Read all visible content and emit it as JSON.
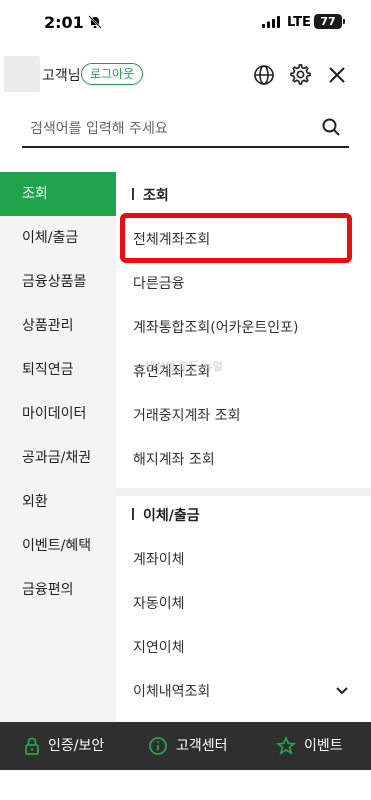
{
  "status_bar": {
    "time": "2:01",
    "network": "LTE",
    "battery": "77"
  },
  "header": {
    "user_name": "고객님",
    "logout_label": "로그아웃"
  },
  "search": {
    "placeholder": "검색어를 입력해 주세요"
  },
  "sidebar": {
    "items": [
      {
        "label": "조회",
        "active": true
      },
      {
        "label": "이체/출금"
      },
      {
        "label": "금융상품몰"
      },
      {
        "label": "상품관리"
      },
      {
        "label": "퇴직연금"
      },
      {
        "label": "마이데이터"
      },
      {
        "label": "공과금/채권"
      },
      {
        "label": "외환"
      },
      {
        "label": "이벤트/혜택"
      },
      {
        "label": "금융편의"
      }
    ]
  },
  "sections": [
    {
      "title": "조회",
      "items": [
        "전체계좌조회",
        "다른금융",
        "계좌통합조회(어카운트인포)",
        "휴면계좌조회",
        "거래중지계좌 조회",
        "해지계좌 조회"
      ]
    },
    {
      "title": "이체/출금",
      "items": [
        "계좌이체",
        "자동이체",
        "지연이체",
        "이체내역조회"
      ]
    }
  ],
  "watermark": "세상의 모든 뉴얼",
  "footer": {
    "items": [
      "인증/보안",
      "고객센터",
      "이벤트"
    ]
  },
  "colors": {
    "brand_green": "#1fa34c",
    "highlight_red": "#e90d0d",
    "footer_bg": "#2f2f2f"
  }
}
